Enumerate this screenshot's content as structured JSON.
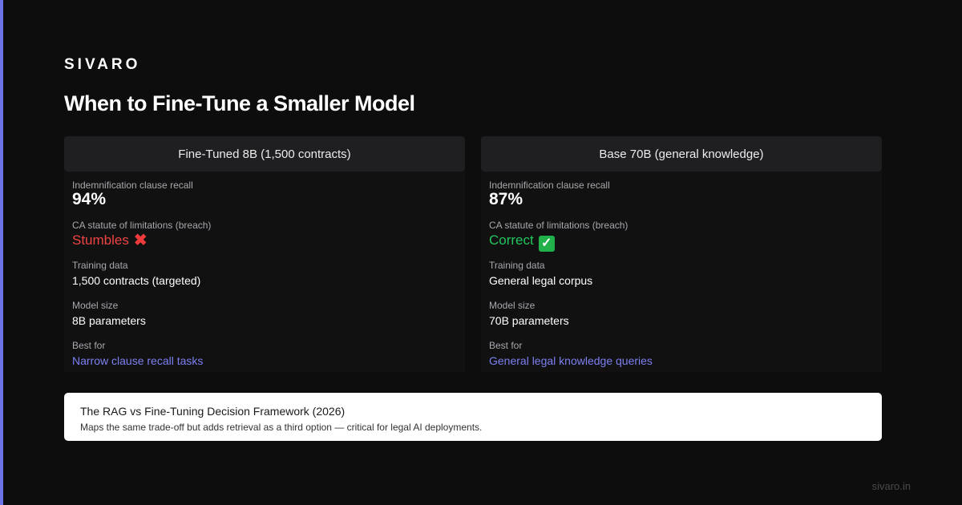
{
  "brand": "SIVARO",
  "title": "When to Fine-Tune a Smaller Model",
  "columns": [
    {
      "header": "Fine-Tuned 8B (1,500 contracts)",
      "rows": [
        {
          "label": "Indemnification clause recall",
          "value": "94%"
        },
        {
          "label": "CA statute of limitations (breach)",
          "value": "Stumbles",
          "status_icon": "cross-mark-icon"
        },
        {
          "label": "Training data",
          "value": "1,500 contracts (targeted)"
        },
        {
          "label": "Model size",
          "value": "8B parameters"
        },
        {
          "label": "Best for",
          "value": "Narrow clause recall tasks"
        }
      ]
    },
    {
      "header": "Base 70B (general knowledge)",
      "rows": [
        {
          "label": "Indemnification clause recall",
          "value": "87%"
        },
        {
          "label": "CA statute of limitations (breach)",
          "value": "Correct",
          "status_icon": "check-mark-icon"
        },
        {
          "label": "Training data",
          "value": "General legal corpus"
        },
        {
          "label": "Model size",
          "value": "70B parameters"
        },
        {
          "label": "Best for",
          "value": "General legal knowledge queries"
        }
      ]
    }
  ],
  "callout": {
    "title": "The RAG vs Fine-Tuning Decision Framework (2026)",
    "description": "Maps the same trade-off but adds retrieval as a third option — critical for legal AI deployments."
  },
  "footer": "sivaro.in",
  "colors": {
    "accent": "#6d72e6",
    "negative": "#ee4444",
    "positive": "#22c55e",
    "link": "#7c80f0"
  }
}
